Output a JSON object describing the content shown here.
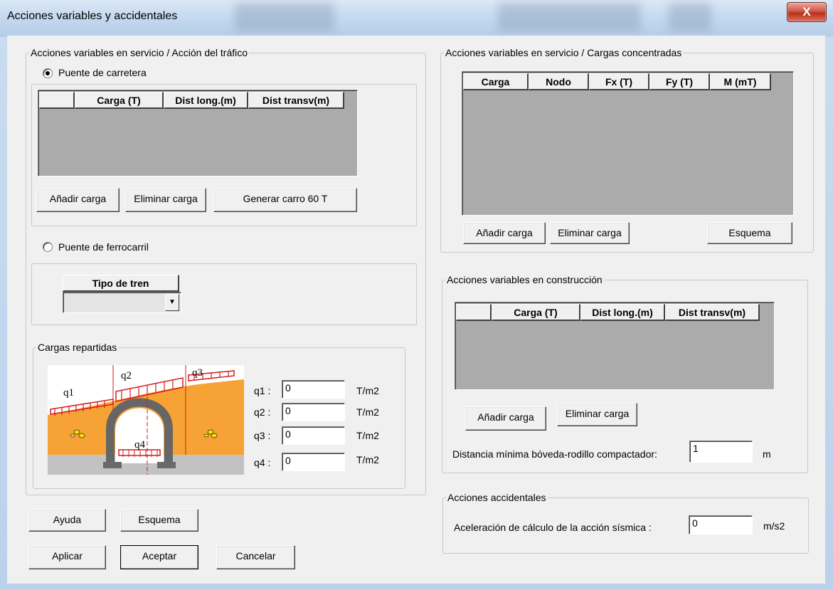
{
  "window": {
    "title": "Acciones variables y accidentales",
    "close_glyph": "X"
  },
  "trafico": {
    "legend": "Acciones variables en servicio / Acción del tráfico",
    "radio_carretera": "Puente de carretera",
    "columns": [
      "",
      "Carga (T)",
      "Dist long.(m)",
      "Dist transv(m)"
    ],
    "add": "Añadir carga",
    "remove": "Eliminar carga",
    "generate": "Generar carro 60 T",
    "radio_ferrocarril": "Puente de ferrocarril",
    "tren_header": "Tipo de tren",
    "tren_value": ""
  },
  "concentradas": {
    "legend": "Acciones variables en servicio / Cargas concentradas",
    "columns": [
      "Carga",
      "Nodo",
      "Fx (T)",
      "Fy (T)",
      "M (mT)"
    ],
    "add": "Añadir carga",
    "remove": "Eliminar carga",
    "scheme": "Esquema"
  },
  "repartidas": {
    "legend": "Cargas repartidas",
    "diagram_labels": {
      "q1": "q1",
      "q2": "q2",
      "q3": "q3",
      "q4": "q4"
    },
    "rows": [
      {
        "label": "q1 :",
        "value": "0",
        "unit": "T/m2"
      },
      {
        "label": "q2 :",
        "value": "0",
        "unit": "T/m2"
      },
      {
        "label": "q3 :",
        "value": "0",
        "unit": "T/m2"
      },
      {
        "label": "q4 :",
        "value": "0",
        "unit": "T/m2"
      }
    ]
  },
  "construccion": {
    "legend": "Acciones variables en construcción",
    "columns": [
      "",
      "Carga (T)",
      "Dist long.(m)",
      "Dist transv(m)"
    ],
    "add": "Añadir carga",
    "remove": "Eliminar carga",
    "distance_label": "Distancia mínima bóveda-rodillo compactador:",
    "distance_value": "1",
    "distance_unit": "m"
  },
  "accidentales": {
    "legend": "Acciones accidentales",
    "label": "Aceleración de cálculo de la acción sísmica :",
    "value": "0",
    "unit": "m/s2"
  },
  "buttons": {
    "help": "Ayuda",
    "scheme": "Esquema",
    "apply": "Aplicar",
    "accept": "Aceptar",
    "cancel": "Cancelar"
  }
}
